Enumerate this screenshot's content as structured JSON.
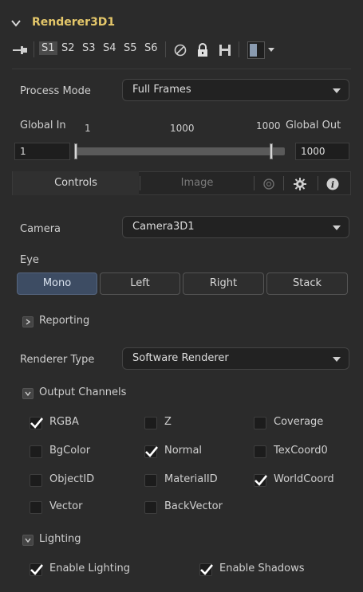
{
  "header": {
    "title": "Renderer3D1"
  },
  "toolbar": {
    "slots": [
      "S1",
      "S2",
      "S3",
      "S4",
      "S5",
      "S6"
    ],
    "active_slot": "S1"
  },
  "process_mode": {
    "label": "Process Mode",
    "value": "Full Frames"
  },
  "global_range": {
    "in_label": "Global In",
    "out_label": "Global Out",
    "in_tick": "1",
    "mid_tick": "1000",
    "out_tick": "1000",
    "in_value": "1",
    "out_value": "1000"
  },
  "tabs": {
    "controls": "Controls",
    "image": "Image"
  },
  "camera": {
    "label": "Camera",
    "value": "Camera3D1"
  },
  "eye": {
    "label": "Eye",
    "options": [
      "Mono",
      "Left",
      "Right",
      "Stack"
    ],
    "selected": "Mono"
  },
  "reporting": {
    "label": "Reporting"
  },
  "renderer_type": {
    "label": "Renderer Type",
    "value": "Software Renderer"
  },
  "output_channels": {
    "label": "Output Channels",
    "items": [
      {
        "label": "RGBA",
        "checked": true
      },
      {
        "label": "Z",
        "checked": false
      },
      {
        "label": "Coverage",
        "checked": false
      },
      {
        "label": "BgColor",
        "checked": false
      },
      {
        "label": "Normal",
        "checked": true
      },
      {
        "label": "TexCoord0",
        "checked": false
      },
      {
        "label": "ObjectID",
        "checked": false
      },
      {
        "label": "MaterialID",
        "checked": false
      },
      {
        "label": "WorldCoord",
        "checked": true
      },
      {
        "label": "Vector",
        "checked": false
      },
      {
        "label": "BackVector",
        "checked": false
      }
    ]
  },
  "lighting": {
    "label": "Lighting",
    "enable_lighting": {
      "label": "Enable Lighting",
      "checked": true
    },
    "enable_shadows": {
      "label": "Enable Shadows",
      "checked": true
    }
  },
  "colors": {
    "title": "#e4c76a",
    "selected_segment": "#3d4c63",
    "panel_bg": "#2b2b2b"
  }
}
